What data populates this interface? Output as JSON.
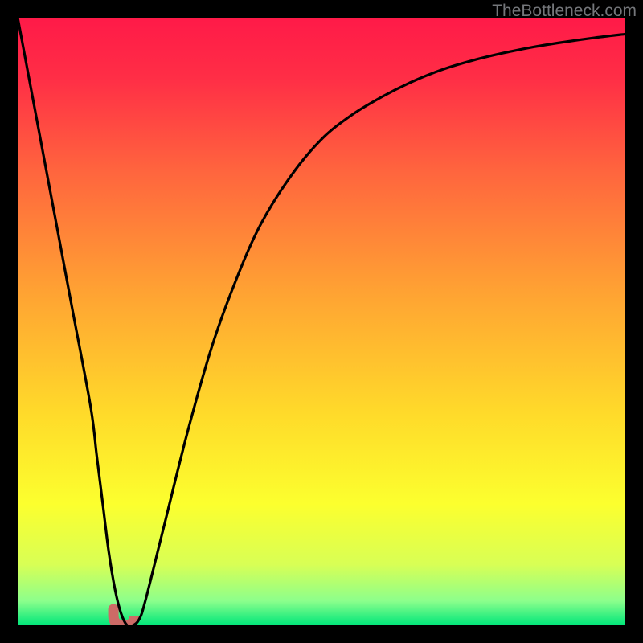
{
  "watermark": "TheBottleneck.com",
  "chart_data": {
    "type": "line",
    "title": "",
    "xlabel": "",
    "ylabel": "",
    "xlim": [
      0,
      100
    ],
    "ylim": [
      0,
      100
    ],
    "grid": false,
    "legend": false,
    "background_gradient": {
      "stops": [
        {
          "offset": 0.0,
          "color": "#ff1a48"
        },
        {
          "offset": 0.1,
          "color": "#ff2e46"
        },
        {
          "offset": 0.25,
          "color": "#ff643e"
        },
        {
          "offset": 0.45,
          "color": "#ffa233"
        },
        {
          "offset": 0.65,
          "color": "#ffda2a"
        },
        {
          "offset": 0.8,
          "color": "#fcff2e"
        },
        {
          "offset": 0.9,
          "color": "#d8ff55"
        },
        {
          "offset": 0.96,
          "color": "#8cff8c"
        },
        {
          "offset": 1.0,
          "color": "#00e67a"
        }
      ]
    },
    "series": [
      {
        "name": "curve",
        "color": "#000000",
        "x": [
          0,
          3,
          6,
          9,
          12,
          13,
          14,
          15,
          16,
          17,
          18,
          19,
          20,
          21,
          24,
          28,
          32,
          36,
          40,
          45,
          50,
          55,
          60,
          65,
          70,
          75,
          80,
          85,
          90,
          95,
          100
        ],
        "values": [
          100,
          84,
          68,
          52,
          36,
          28,
          20,
          12,
          6,
          2,
          0,
          0,
          1,
          4,
          16,
          32,
          46,
          57,
          66,
          74,
          80,
          84,
          87,
          89.5,
          91.5,
          93,
          94.2,
          95.2,
          96,
          96.7,
          97.3
        ]
      }
    ],
    "marker": {
      "name": "bottleneck-point",
      "color": "#cd6a66",
      "x": 17.5,
      "width": 3.5,
      "y": 0.8
    }
  }
}
